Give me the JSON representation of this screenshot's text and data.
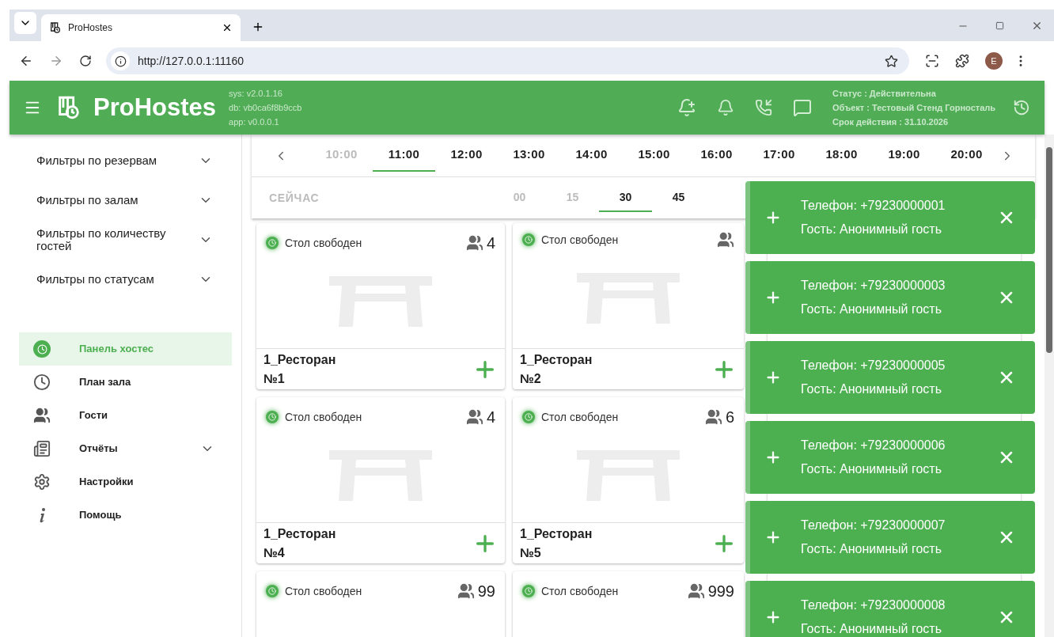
{
  "browser": {
    "tab_title": "ProHostes",
    "url": "http://127.0.0.1:11160",
    "profile_initial": "E"
  },
  "header": {
    "logo": "ProHostes",
    "versions": [
      "sys: v2.0.1.16",
      "db: vb0ca6f8b9ccb",
      "app: v0.0.0.1"
    ],
    "license": [
      "Статус : Действительна",
      "Объект : Тестовый Стенд Горносталь",
      "Срок действия : 31.10.2026"
    ]
  },
  "filters": [
    {
      "label": "Фильтры по резервам",
      "expanded": false
    },
    {
      "label": "Фильтры по залам",
      "expanded": false
    },
    {
      "label": "Фильтры по количеству гостей",
      "expanded": false
    },
    {
      "label": "Фильтры по статусам",
      "expanded": false
    }
  ],
  "nav": [
    {
      "kind": "hostess",
      "label": "Панель хостес",
      "selected": true
    },
    {
      "kind": "plan",
      "label": "План зала",
      "selected": false
    },
    {
      "kind": "guests",
      "label": "Гости",
      "selected": false
    },
    {
      "kind": "reports",
      "label": "Отчёты",
      "selected": false,
      "expandable": true
    },
    {
      "kind": "settings",
      "label": "Настройки",
      "selected": false
    },
    {
      "kind": "help",
      "label": "Помощь",
      "selected": false
    }
  ],
  "hours": [
    {
      "label": "10:00",
      "selected": false,
      "disabled": true
    },
    {
      "label": "11:00",
      "selected": true,
      "disabled": false
    },
    {
      "label": "12:00",
      "selected": false,
      "disabled": false
    },
    {
      "label": "13:00",
      "selected": false,
      "disabled": false
    },
    {
      "label": "14:00",
      "selected": false,
      "disabled": false
    },
    {
      "label": "15:00",
      "selected": false,
      "disabled": false
    },
    {
      "label": "16:00",
      "selected": false,
      "disabled": false
    },
    {
      "label": "17:00",
      "selected": false,
      "disabled": false
    },
    {
      "label": "18:00",
      "selected": false,
      "disabled": false
    },
    {
      "label": "19:00",
      "selected": false,
      "disabled": false
    },
    {
      "label": "20:00",
      "selected": false,
      "disabled": false
    }
  ],
  "now_button": "СЕЙЧАС",
  "minutes": [
    {
      "label": "00",
      "selected": false,
      "disabled": true
    },
    {
      "label": "15",
      "selected": false,
      "disabled": true
    },
    {
      "label": "30",
      "selected": true,
      "disabled": false
    },
    {
      "label": "45",
      "selected": false,
      "disabled": false
    }
  ],
  "tables": [
    {
      "status": "Стол свободен",
      "guests": "4",
      "hall": "1_Ресторан",
      "number": "№1"
    },
    {
      "status": "Стол свободен",
      "hall": "1_Ресторан",
      "number": "№2"
    },
    {
      "status": "Стол свободен",
      "guests": "4",
      "hall": "1_Ресторан",
      "number": "№4"
    },
    {
      "status": "Стол свободен",
      "guests": "6",
      "hall": "1_Ресторан",
      "number": "№5"
    },
    {
      "status": "Стол свободен",
      "guests": "99"
    },
    {
      "status": "Стол свободен",
      "guests": "999"
    }
  ],
  "notifications": [
    {
      "phone": "Телефон: +79230000001",
      "guest": "Гость: Анонимный гость"
    },
    {
      "phone": "Телефон: +79230000003",
      "guest": "Гость: Анонимный гость"
    },
    {
      "phone": "Телефон: +79230000005",
      "guest": "Гость: Анонимный гость"
    },
    {
      "phone": "Телефон: +79230000006",
      "guest": "Гость: Анонимный гость"
    },
    {
      "phone": "Телефон: +79230000007",
      "guest": "Гость: Анонимный гость"
    },
    {
      "phone": "Телефон: +79230000008",
      "guest": "Гость: Анонимный гость"
    }
  ]
}
